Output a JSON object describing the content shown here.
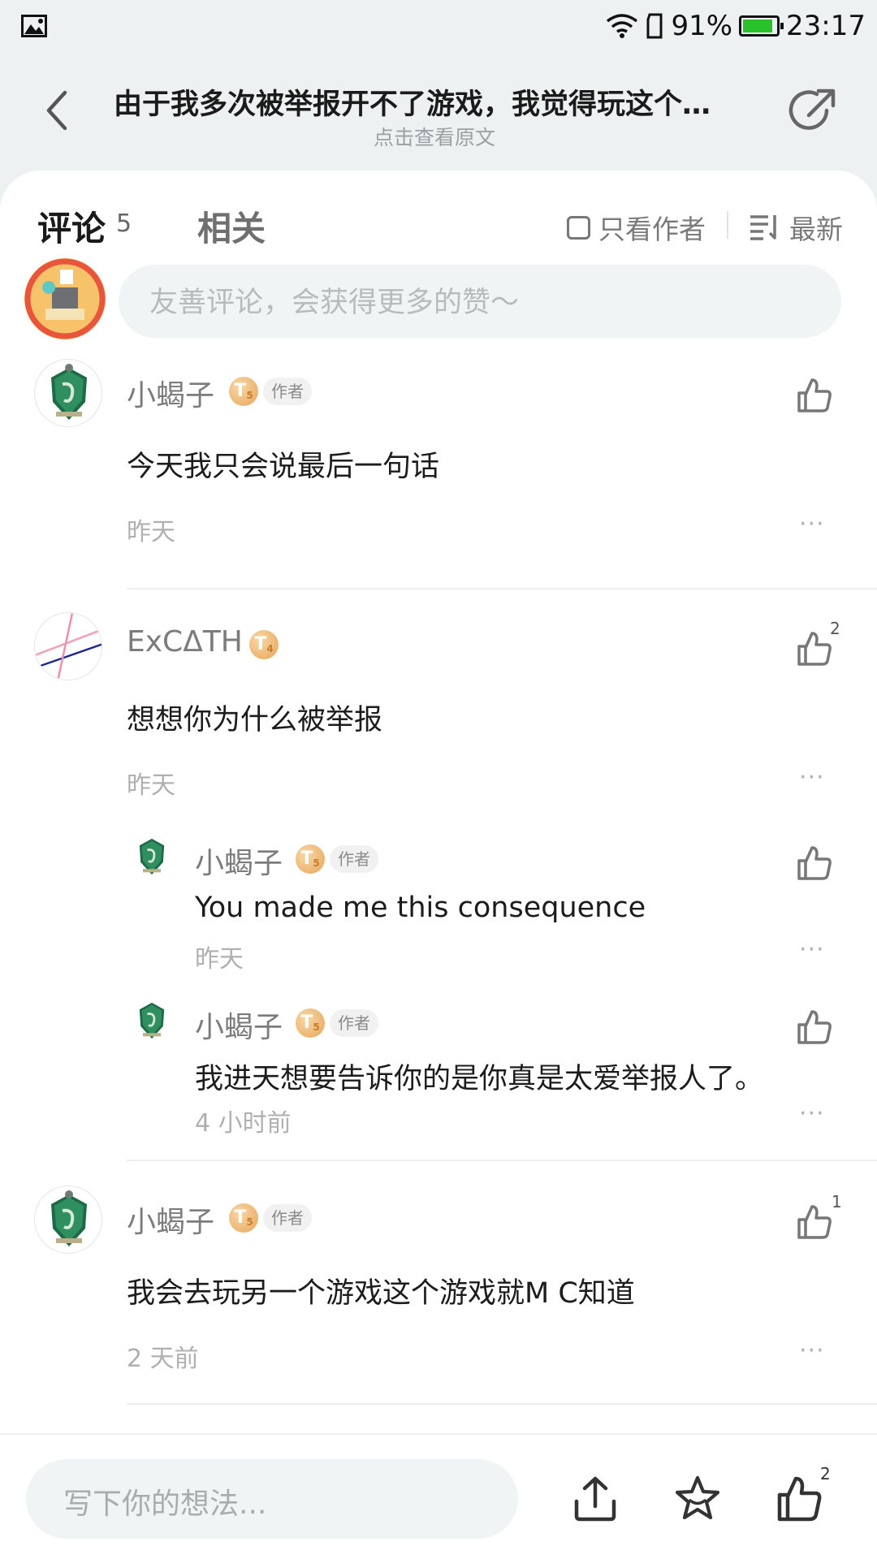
{
  "status_bar": {
    "battery_percent": "91%",
    "battery_level": 0.91,
    "time": "23:17"
  },
  "header": {
    "title": "由于我多次被举报开不了游戏，我觉得玩这个…",
    "subtitle": "点击查看原文"
  },
  "tabs": {
    "comments_label": "评论",
    "comments_count": "5",
    "related_label": "相关",
    "author_only_label": "只看作者",
    "sort_label": "最新"
  },
  "comment_input": {
    "placeholder": "友善评论，会获得更多的赞～"
  },
  "comments": [
    {
      "name": "小蝎子",
      "level": "T",
      "level_num": "5",
      "tag": "作者",
      "text": "今天我只会说最后一句话",
      "time": "昨天",
      "likes": ""
    },
    {
      "name": "ExCΔTH",
      "level": "T",
      "level_num": "4",
      "text": "想想你为什么被举报",
      "time": "昨天",
      "likes": "2",
      "replies": [
        {
          "name": "小蝎子",
          "level": "T",
          "level_num": "5",
          "tag": "作者",
          "text": "You made me this consequence",
          "time": "昨天"
        },
        {
          "name": "小蝎子",
          "level": "T",
          "level_num": "5",
          "tag": "作者",
          "text": "我进天想要告诉你的是你真是太爱举报人了。",
          "time": "4 小时前"
        }
      ]
    },
    {
      "name": "小蝎子",
      "level": "T",
      "level_num": "5",
      "tag": "作者",
      "text": "我会去玩另一个游戏这个游戏就M C知道",
      "time": "2 天前",
      "likes": "1"
    }
  ],
  "bottom_bar": {
    "placeholder": "写下你的想法...",
    "like_count": "2"
  },
  "more_glyph": "···",
  "colors": {
    "accent": "#34c6c6",
    "level_badge": "#e7a65b",
    "battery_fill": "#29c22b"
  }
}
